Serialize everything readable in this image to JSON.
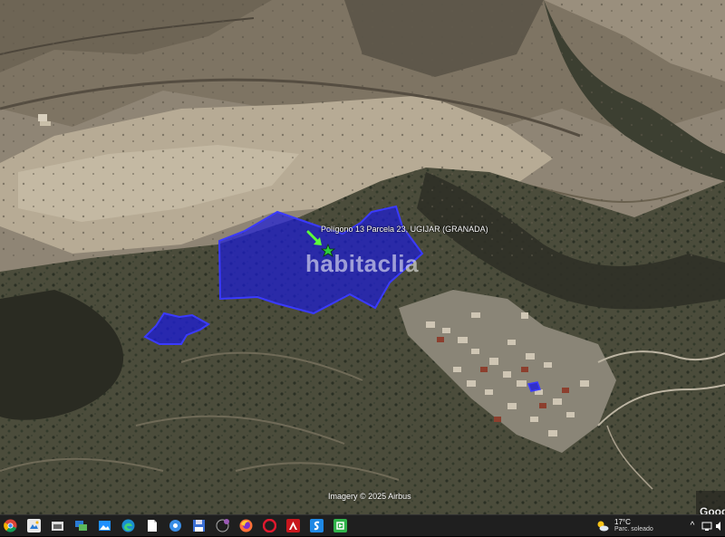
{
  "map": {
    "placemark_label": "Polígono 13 Parcela 23, UGIJAR (GRANADA)",
    "watermark": "habitaclia",
    "imagery_credit": "Imagery © 2025 Airbus",
    "brand": "Google",
    "polygon_color": "#1a1adc",
    "outline_color": "#3a3aff",
    "marker_color": "#2ecc40",
    "arrow_color": "#5cff3a"
  },
  "taskbar": {
    "icons": [
      "chrome-icon",
      "file-explorer-icon",
      "store-icon",
      "remote-desktop-icon",
      "photos-icon",
      "edge-icon",
      "document-icon",
      "settings-icon",
      "save-icon",
      "whatsapp-icon",
      "firefox-icon",
      "acrobat-icon",
      "skype-icon",
      "app-icon"
    ],
    "weather": {
      "temperature": "17°C",
      "condition": "Parc. soleado"
    }
  }
}
